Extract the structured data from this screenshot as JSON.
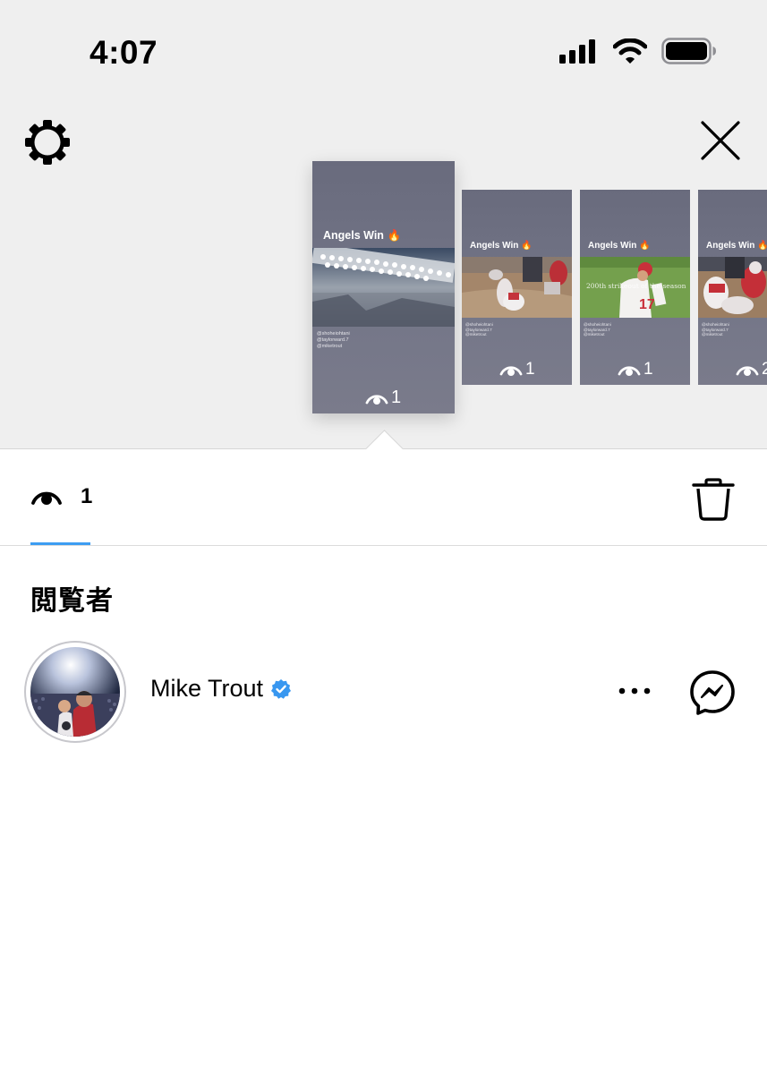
{
  "status_bar": {
    "time": "4:07",
    "icons": [
      "signal-bars-icon",
      "wifi-icon",
      "battery-icon"
    ]
  },
  "header": {
    "settings_icon": "gear-icon",
    "close_icon": "close-icon"
  },
  "stories": [
    {
      "title": "Angels Win",
      "emoji": "🔥",
      "tags": [
        "@shoheiohtani",
        "@taylorward.7",
        "@miketrout"
      ],
      "caption": "",
      "views": "1",
      "active": true
    },
    {
      "title": "Angels Win",
      "emoji": "🔥",
      "tags": [
        "@shoheiohtani",
        "@taylorward.7",
        "@miketrout"
      ],
      "caption": "",
      "views": "1",
      "active": false
    },
    {
      "title": "Angels Win",
      "emoji": "🔥",
      "tags": [
        "@shoheiohtani",
        "@taylorward.7",
        "@miketrout"
      ],
      "caption": "200th strikeout of the season",
      "views": "1",
      "active": false
    },
    {
      "title": "Angels Win",
      "emoji": "🔥",
      "tags": [
        "@shoheiohtani",
        "@taylorward.7",
        "@miketrout"
      ],
      "caption": "",
      "views": "2",
      "active": false
    }
  ],
  "views_panel": {
    "count": "1",
    "eye_icon": "eye-icon",
    "delete_icon": "trash-icon",
    "accent_color": "#3d9df2"
  },
  "viewers_section": {
    "title": "閲覧者",
    "viewers": [
      {
        "name": "Mike Trout",
        "verified": true,
        "verified_color": "#3897f0",
        "more_icon": "more-dots-icon",
        "message_icon": "messenger-icon"
      }
    ]
  }
}
